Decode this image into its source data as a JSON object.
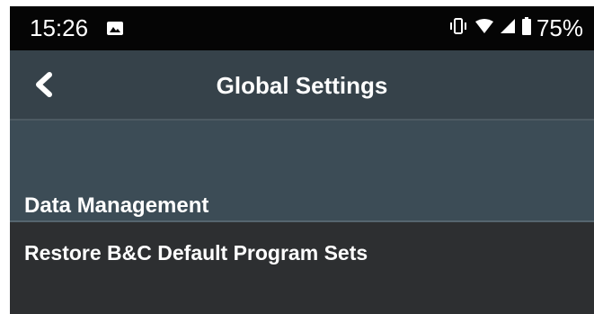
{
  "status_bar": {
    "time": "15:26",
    "battery": "75%",
    "icons": [
      "image-icon",
      "vibrate-icon",
      "wifi-icon",
      "signal-icon",
      "battery-icon"
    ]
  },
  "app_bar": {
    "title": "Global Settings",
    "back_icon": "back-chevron-icon"
  },
  "section": {
    "title": "Data Management"
  },
  "items": [
    {
      "label": "Restore B&C Default Program Sets"
    }
  ],
  "colors": {
    "status_bar_bg": "#050505",
    "app_bar_bg": "#36424a",
    "section_bg": "#3c4c56",
    "list_bg": "#2d2f31",
    "text": "#ffffff"
  }
}
